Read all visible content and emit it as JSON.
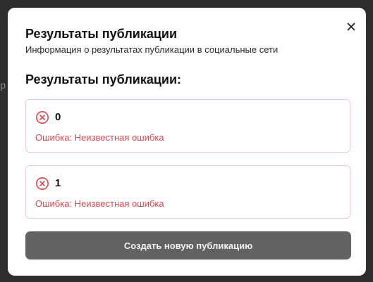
{
  "backdrop": {
    "partial_text": "ер"
  },
  "dialog": {
    "title": "Результаты публикации",
    "subtitle": "Информация о результатах публикации в социальные сети",
    "close_icon": "close-icon",
    "section_heading": "Результаты публикации:",
    "results": [
      {
        "id": "0",
        "status": "error",
        "icon": "error-circle-x-icon",
        "message": "Ошибка: Неизвестная ошибка"
      },
      {
        "id": "1",
        "status": "error",
        "icon": "error-circle-x-icon",
        "message": "Ошибка: Неизвестная ошибка"
      }
    ],
    "create_button_label": "Создать новую публикацию"
  },
  "colors": {
    "error": "#e0454f",
    "card_border": "#f3c9cc",
    "button_bg": "#626262",
    "backdrop": "#2e2e2e"
  }
}
